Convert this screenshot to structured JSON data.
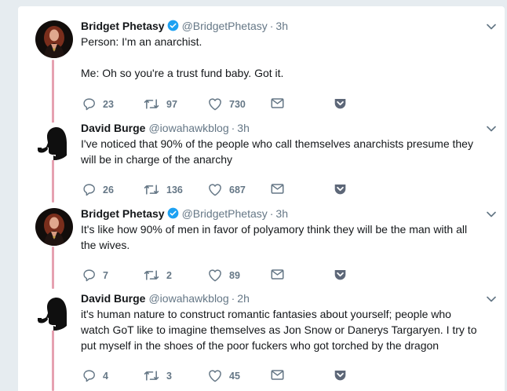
{
  "tweets": [
    {
      "name": "Bridget Phetasy",
      "handle": "@BridgetPhetasy",
      "dot": "·",
      "time": "3h",
      "verified": true,
      "avatar": "woman-portrait",
      "lines": [
        "Person: I'm an anarchist.",
        "",
        "Me: Oh so you're a trust fund baby. Got it."
      ],
      "replies": "23",
      "retweets": "97",
      "likes": "730"
    },
    {
      "name": "David Burge",
      "handle": "@iowahawkblog",
      "dot": "·",
      "time": "3h",
      "verified": false,
      "avatar": "pipe-smoker-silhouette",
      "lines": [
        "I've noticed that 90% of the people who call themselves anarchists presume they",
        "will be in charge of the anarchy"
      ],
      "replies": "26",
      "retweets": "136",
      "likes": "687"
    },
    {
      "name": "Bridget Phetasy",
      "handle": "@BridgetPhetasy",
      "dot": "·",
      "time": "3h",
      "verified": true,
      "avatar": "woman-portrait",
      "lines": [
        "It's like how 90% of men in favor of polyamory think they will be the man with all",
        "the wives."
      ],
      "replies": "7",
      "retweets": "2",
      "likes": "89"
    },
    {
      "name": "David Burge",
      "handle": "@iowahawkblog",
      "dot": "·",
      "time": "2h",
      "verified": false,
      "avatar": "pipe-smoker-silhouette",
      "lines": [
        "it's human nature to construct romantic fantasies about yourself; people who",
        "watch GoT like to imagine themselves as Jon Snow or Danerys Targaryen. I try to",
        "put myself in the shoes of the poor fuckers who got torched by the dragon"
      ],
      "replies": "4",
      "retweets": "3",
      "likes": "45"
    }
  ],
  "colors": {
    "thread_line": "#e6a1b1",
    "verified": "#1da1f2",
    "secondary_text": "#657786",
    "primary_text": "#14171a"
  },
  "icons": [
    "reply-icon",
    "retweet-icon",
    "like-icon",
    "message-icon",
    "pocket-icon",
    "chevron-down-icon",
    "verified-badge-icon"
  ]
}
